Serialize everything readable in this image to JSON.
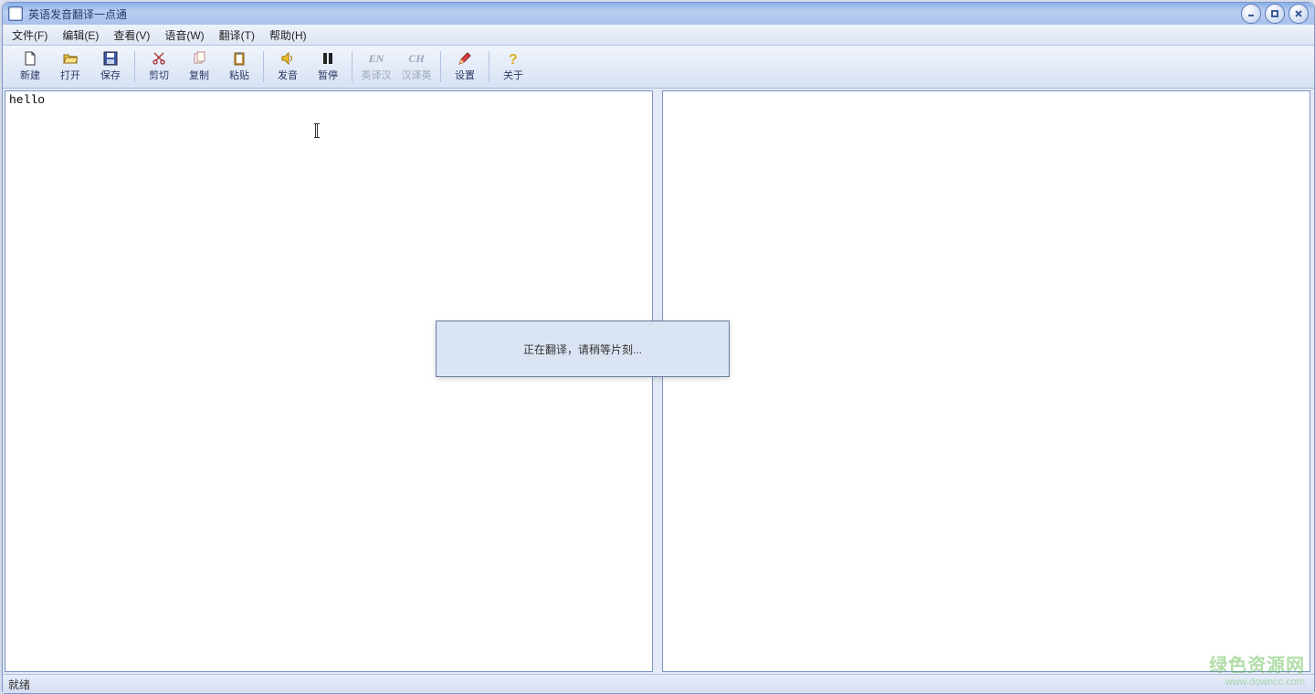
{
  "window": {
    "title": "英语发音翻译一点通"
  },
  "menubar": {
    "file": "文件(F)",
    "edit": "编辑(E)",
    "view": "查看(V)",
    "voice": "语音(W)",
    "trans": "翻译(T)",
    "help": "帮助(H)"
  },
  "toolbar": {
    "new": "新建",
    "open": "打开",
    "save": "保存",
    "cut": "剪切",
    "copy": "复制",
    "paste": "粘贴",
    "speak": "发音",
    "pause": "暂停",
    "en2cn": "英译汉",
    "cn2en": "汉译英",
    "settings": "设置",
    "about": "关于",
    "en_icon_text": "EN",
    "ch_icon_text": "CH"
  },
  "editor": {
    "left_text": "hello",
    "right_text": ""
  },
  "dialog": {
    "message": "正在翻译，请稍等片刻..."
  },
  "statusbar": {
    "text": "就绪"
  },
  "watermark": {
    "line1": "绿色资源网",
    "line2": "www.downcc.com"
  }
}
